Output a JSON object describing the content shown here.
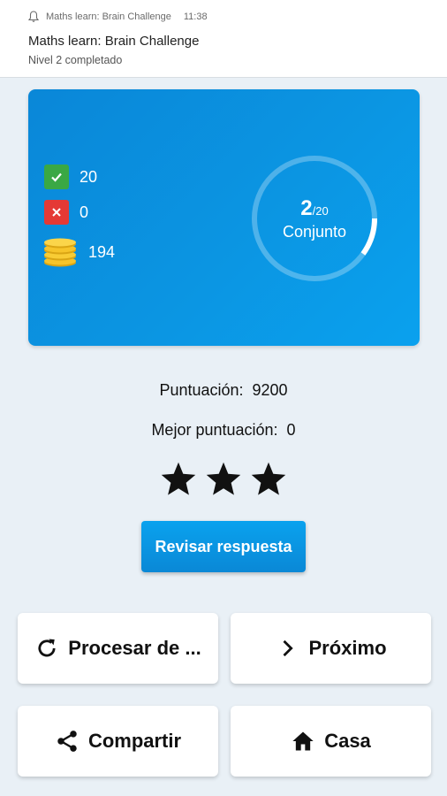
{
  "notification": {
    "app_name": "Maths learn: Brain Challenge",
    "time": "11:38",
    "title": "Maths learn: Brain Challenge",
    "subtitle": "Nivel 2 completado"
  },
  "results": {
    "correct": "20",
    "wrong": "0",
    "coins": "194",
    "set_current": "2",
    "set_total": "/20",
    "set_label": "Conjunto",
    "set_progress_fraction": 0.1
  },
  "score": {
    "label": "Puntuación:",
    "value": "9200",
    "best_label": "Mejor puntuación:",
    "best_value": "0",
    "stars": 3
  },
  "buttons": {
    "review": "Revisar respuesta",
    "retry": "Procesar de ...",
    "next": "Próximo",
    "share": "Compartir",
    "home": "Casa"
  },
  "colors": {
    "card_blue": "#0b95e2",
    "correct_green": "#3aa844",
    "wrong_red": "#e53935",
    "background": "#e9f0f6"
  }
}
